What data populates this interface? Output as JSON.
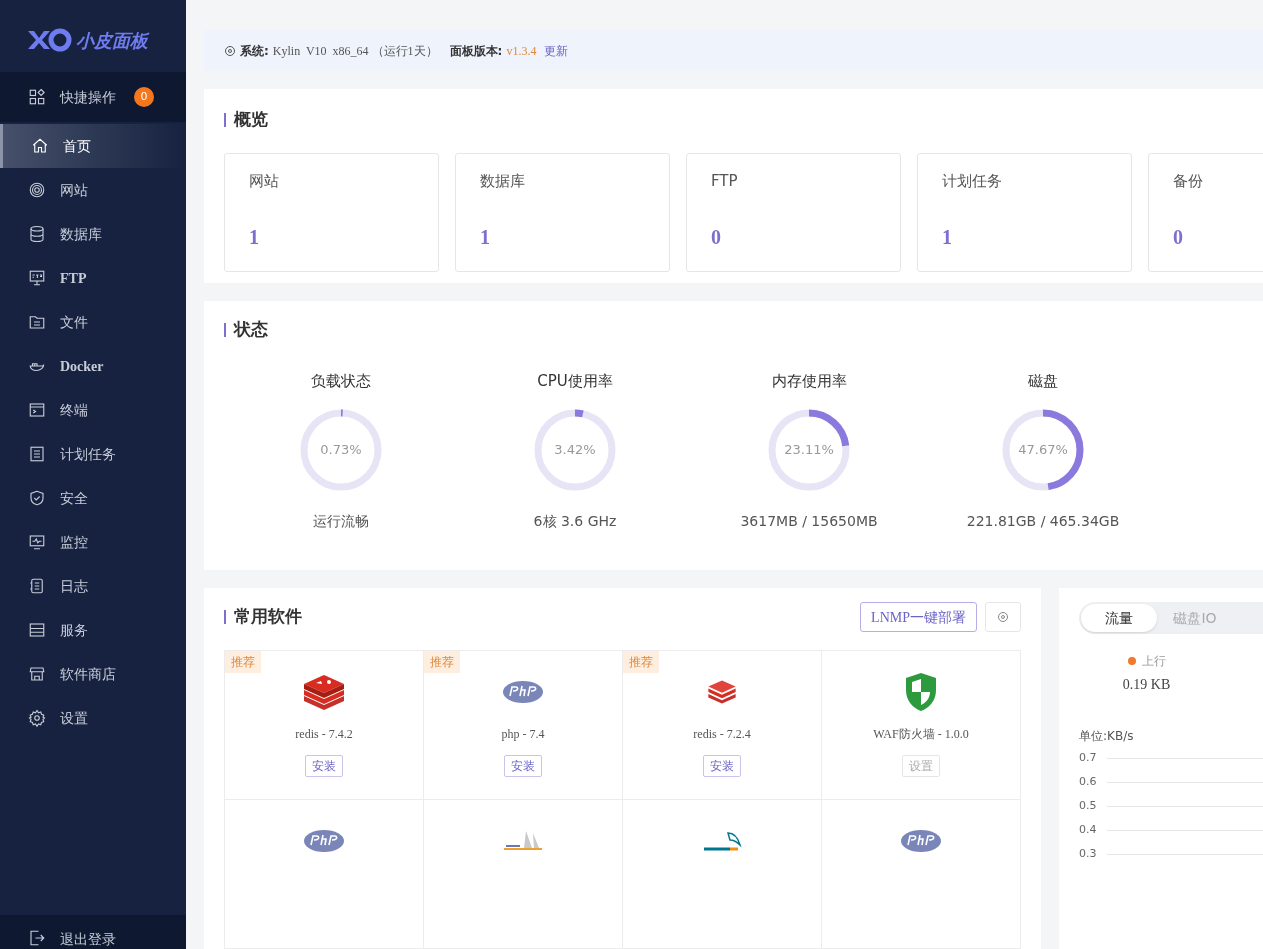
{
  "sidebar": {
    "logo_text": "小皮面板",
    "quick_actions": {
      "label": "快捷操作",
      "count": "0"
    },
    "items": [
      {
        "label": "首页",
        "selected": true
      },
      {
        "label": "网站",
        "selected": false
      },
      {
        "label": "数据库",
        "selected": false
      },
      {
        "label": "FTP",
        "selected": false
      },
      {
        "label": "文件",
        "selected": false
      },
      {
        "label": "Docker",
        "selected": false
      },
      {
        "label": "终端",
        "selected": false
      },
      {
        "label": "计划任务",
        "selected": false
      },
      {
        "label": "安全",
        "selected": false
      },
      {
        "label": "监控",
        "selected": false
      },
      {
        "label": "日志",
        "selected": false
      },
      {
        "label": "服务",
        "selected": false
      },
      {
        "label": "软件商店",
        "selected": false
      },
      {
        "label": "设置",
        "selected": false
      }
    ],
    "logout": "退出登录"
  },
  "info_bar": {
    "system_label": "系统:",
    "system": "Kylin  V10  x86_64 （运行1天）",
    "version_label": "面板版本:",
    "version": "v1.3.4",
    "update": "更新"
  },
  "overview": {
    "title": "概览",
    "cards": [
      {
        "label": "网站",
        "value": "1"
      },
      {
        "label": "数据库",
        "value": "1"
      },
      {
        "label": "FTP",
        "value": "0"
      },
      {
        "label": "计划任务",
        "value": "1"
      },
      {
        "label": "备份",
        "value": "0"
      }
    ]
  },
  "status": {
    "title": "状态",
    "gauges": [
      {
        "label": "负载状态",
        "level": 0.0073,
        "reading": "0.73%",
        "detail": "运行流畅"
      },
      {
        "label": "CPU使用率",
        "level": 0.0342,
        "reading": "3.42%",
        "detail": "6核 3.6 GHz"
      },
      {
        "label": "内存使用率",
        "level": 0.2311,
        "reading": "23.11%",
        "detail": "3617MB / 15650MB"
      },
      {
        "label": "磁盘",
        "level": 0.4767,
        "reading": "47.67%",
        "detail": "221.81GB / 465.34GB"
      }
    ]
  },
  "software": {
    "title": "常用软件",
    "deploy_button": "LNMP一键部署",
    "items": [
      {
        "kind": "app",
        "badge": "推荐",
        "name": "redis - 7.4.2",
        "action": "安装",
        "disabled": false
      },
      {
        "kind": "app",
        "badge": "推荐",
        "name": "php - 7.4",
        "action": "安装",
        "disabled": false
      },
      {
        "kind": "app",
        "badge": "推荐",
        "name": "redis - 7.2.4",
        "action": "安装",
        "disabled": false
      },
      {
        "kind": "app",
        "name": "WAF防火墙 - 1.0.0",
        "action": "设置",
        "disabled": true
      },
      {
        "kind": "app"
      },
      {
        "kind": "app"
      },
      {
        "kind": "app"
      },
      {
        "kind": "app"
      }
    ]
  },
  "traffic": {
    "tabs": [
      {
        "label": "流量",
        "selected": true
      },
      {
        "label": "磁盘IO",
        "selected": false
      }
    ],
    "legend": {
      "label": "上行",
      "color": "#f07a2a",
      "value": "0.19 KB"
    },
    "unit": "单位:KB/s",
    "y_ticks": [
      "0.7",
      "0.6",
      "0.5",
      "0.4",
      "0.3"
    ]
  }
}
